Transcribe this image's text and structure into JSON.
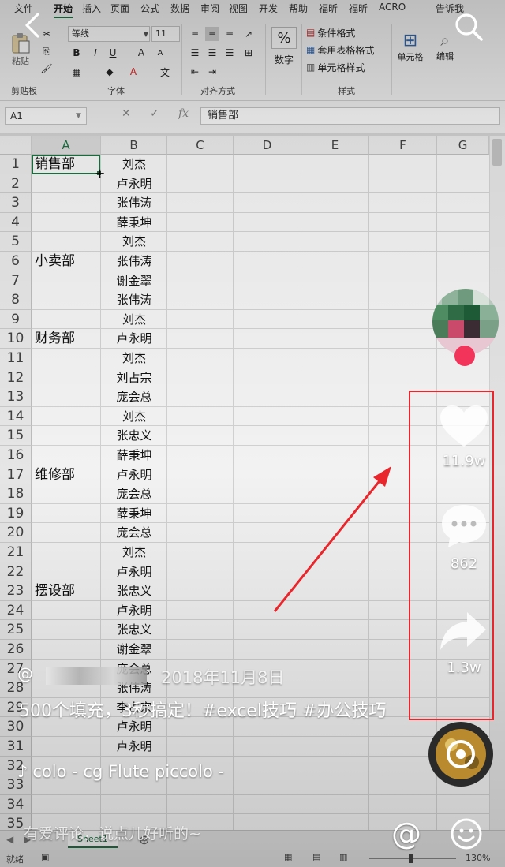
{
  "ribbon": {
    "tabs": [
      "文件",
      "开始",
      "插入",
      "页面",
      "公式",
      "数据",
      "审阅",
      "视图",
      "开发",
      "帮助",
      "福昕",
      "福昕",
      "ACRO",
      "告诉我"
    ],
    "font_name": "等线",
    "font_size": "11",
    "clipboard_paste": "粘贴",
    "number_format_label": "数字",
    "percent_symbol": "%",
    "styles": {
      "conditional": "条件格式",
      "table": "套用表格格式",
      "cell_style": "单元格样式"
    },
    "cells_label": "单元格",
    "editing_label": "编辑",
    "groups": {
      "clipboard": "剪贴板",
      "font": "字体",
      "alignment": "对齐方式",
      "styles": "样式"
    }
  },
  "formula_bar": {
    "name_box": "A1",
    "fx": "fx",
    "content": "销售部"
  },
  "grid": {
    "columns": [
      "A",
      "B",
      "C",
      "D",
      "E",
      "F",
      "G"
    ],
    "rows": [
      "1",
      "2",
      "3",
      "4",
      "5",
      "6",
      "7",
      "8",
      "9",
      "10",
      "11",
      "12",
      "13",
      "14",
      "15",
      "16",
      "17",
      "18",
      "19",
      "20",
      "21",
      "22",
      "23",
      "24",
      "25",
      "26",
      "27",
      "28",
      "29",
      "30",
      "31",
      "32",
      "33",
      "34",
      "35"
    ],
    "col_a": [
      {
        "row": 1,
        "text": "销售部"
      },
      {
        "row": 6,
        "text": "小卖部"
      },
      {
        "row": 10,
        "text": "财务部"
      },
      {
        "row": 17,
        "text": "维修部"
      },
      {
        "row": 23,
        "text": "摆设部"
      }
    ],
    "col_b": [
      "刘杰",
      "卢永明",
      "张伟涛",
      "薛秉坤",
      "刘杰",
      "张伟涛",
      "谢金翠",
      "张伟涛",
      "刘杰",
      "卢永明",
      "刘杰",
      "刘占宗",
      "庞会总",
      "刘杰",
      "张忠义",
      "薛秉坤",
      "卢永明",
      "庞会总",
      "薛秉坤",
      "庞会总",
      "刘杰",
      "卢永明",
      "张忠义",
      "卢永明",
      "张忠义",
      "谢金翠",
      "庞会总",
      "张伟涛",
      "李占宗",
      "卢永明",
      "卢永明"
    ]
  },
  "sheet": {
    "tab": "Sheet1",
    "status_left": "就绪",
    "zoom": "130%"
  },
  "video": {
    "author_symbol": "@",
    "date": "2018年11月8日",
    "caption": "500个填充，3秒搞定！#excel技巧 #办公技巧",
    "music": "colo - cg    Flute piccolo - ",
    "likes": "11.9w",
    "comments": "862",
    "shares": "1.3w",
    "comment_placeholder": "有爱评论，说点儿好听的~",
    "at_symbol": "@"
  },
  "colors": {
    "excel_green": "#217346",
    "annotation_red": "#e8262c",
    "follow_pink": "#f2345a"
  }
}
